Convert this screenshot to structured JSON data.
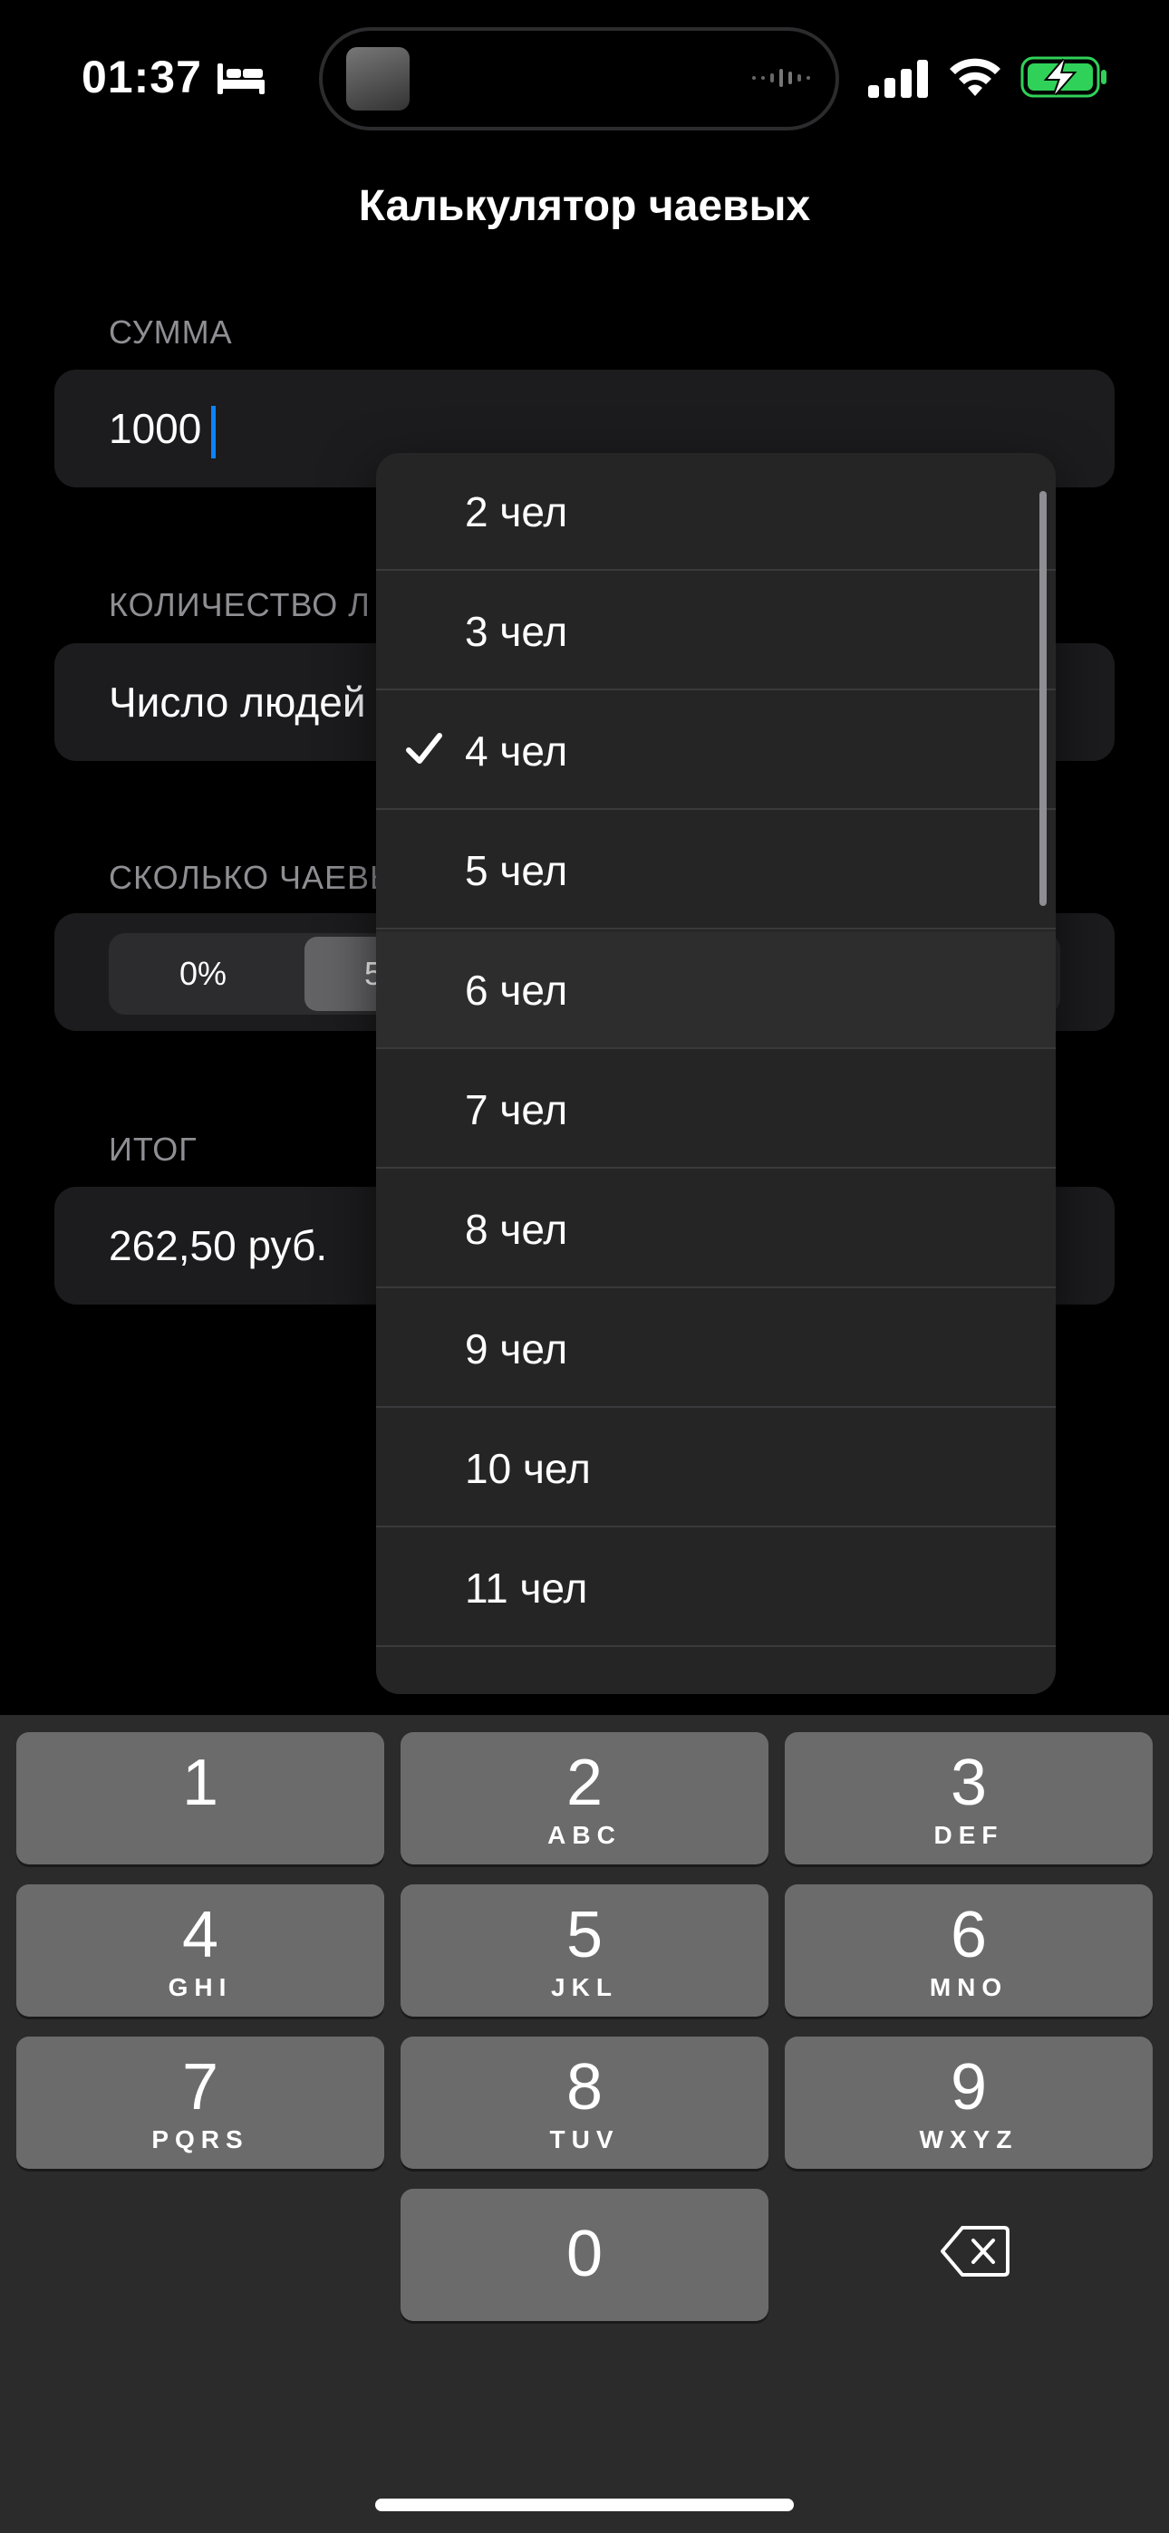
{
  "status_bar": {
    "time": "01:37",
    "icons": [
      "bed-icon",
      "signal-icon",
      "wifi-icon",
      "battery-charging-icon"
    ]
  },
  "nav": {
    "title": "Калькулятор чаевых"
  },
  "sections": {
    "amount": {
      "header": "СУММА",
      "value": "1000"
    },
    "people": {
      "header": "КОЛИЧЕСТВО Л",
      "value": "Число людей"
    },
    "tips": {
      "header": "СКОЛЬКО ЧАЕВЫ",
      "segments": [
        "0%",
        "5"
      ]
    },
    "total": {
      "header": "ИТОГ",
      "value": "262,50 руб."
    }
  },
  "menu": {
    "selected": "4 чел",
    "items": [
      "2 чел",
      "3 чел",
      "4 чел",
      "5 чел",
      "6 чел",
      "7 чел",
      "8 чел",
      "9 чел",
      "10 чел",
      "11 чел"
    ]
  },
  "keyboard": {
    "keys": [
      {
        "num": "1",
        "letters": ""
      },
      {
        "num": "2",
        "letters": "ABC"
      },
      {
        "num": "3",
        "letters": "DEF"
      },
      {
        "num": "4",
        "letters": "GHI"
      },
      {
        "num": "5",
        "letters": "JKL"
      },
      {
        "num": "6",
        "letters": "MNO"
      },
      {
        "num": "7",
        "letters": "PQRS"
      },
      {
        "num": "8",
        "letters": "TUV"
      },
      {
        "num": "9",
        "letters": "WXYZ"
      },
      {
        "num": "0",
        "letters": ""
      }
    ],
    "delete_icon": "delete-left-icon"
  },
  "colors": {
    "background": "#000000",
    "row": "#1c1c1e",
    "accent_cursor": "#0a84ff",
    "battery_green": "#30d158"
  }
}
